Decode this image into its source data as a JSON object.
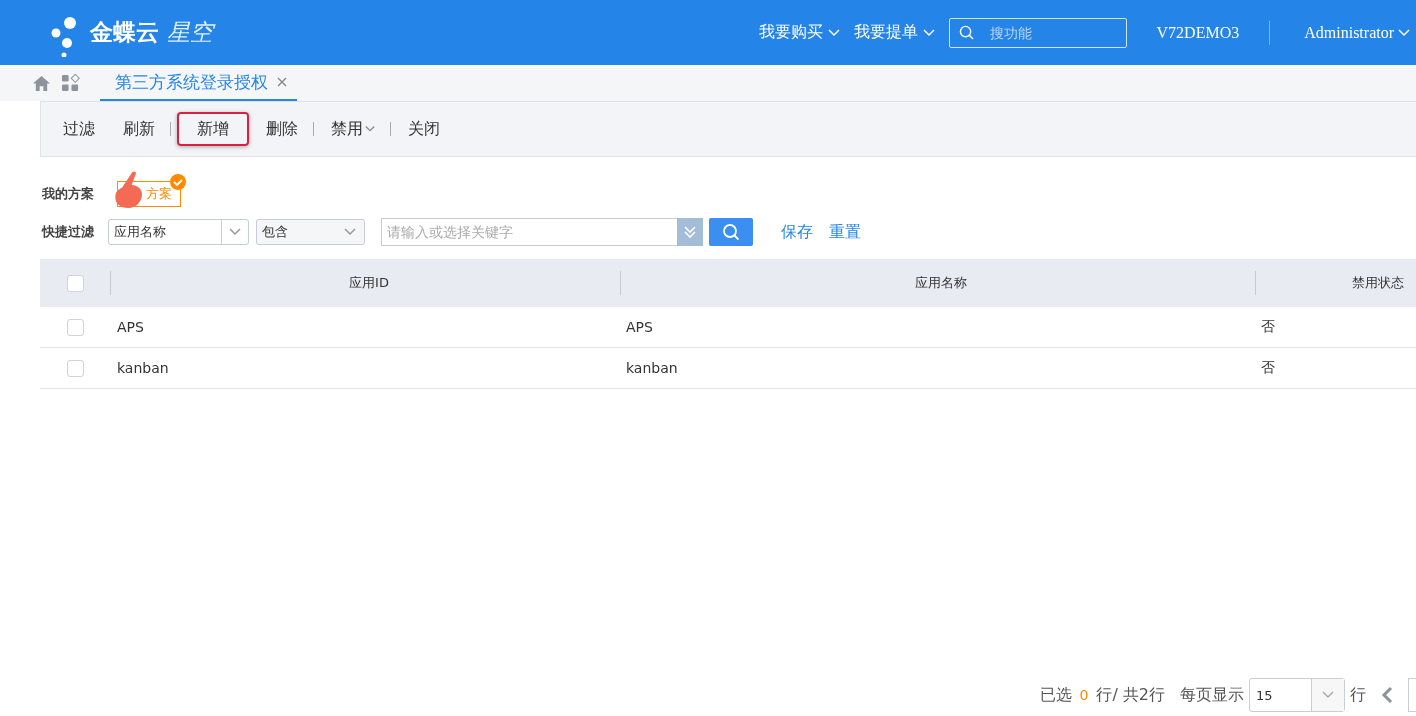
{
  "header": {
    "logo": {
      "brand": "金蝶云",
      "product": "星空"
    },
    "menus": [
      {
        "label": "我要购买"
      },
      {
        "label": "我要提单"
      }
    ],
    "search": {
      "placeholder": "搜功能"
    },
    "data_center": "V72DEMO3",
    "user": "Administrator"
  },
  "tabs": [
    {
      "label": "第三方系统登录授权",
      "selected": true
    }
  ],
  "toolbar": [
    {
      "label": "过滤",
      "separator_after": false,
      "dropdown": false,
      "highlighted": false
    },
    {
      "label": "刷新",
      "separator_after": true,
      "dropdown": false,
      "highlighted": false
    },
    {
      "label": "新增",
      "separator_after": false,
      "dropdown": false,
      "highlighted": true
    },
    {
      "label": "删除",
      "separator_after": true,
      "dropdown": false,
      "highlighted": false
    },
    {
      "label": "禁用",
      "separator_after": true,
      "dropdown": true,
      "highlighted": false
    },
    {
      "label": "关闭",
      "separator_after": false,
      "dropdown": false,
      "highlighted": false
    }
  ],
  "schemes": {
    "label": "我的方案",
    "items": [
      {
        "label": "方案",
        "selected": true
      }
    ]
  },
  "quick_filter": {
    "label": "快捷过滤",
    "field": "应用名称",
    "operator": "包含",
    "keyword_placeholder": "请输入或选择关键字",
    "actions": [
      "保存",
      "重置"
    ]
  },
  "table": {
    "columns": [
      "应用ID",
      "应用名称",
      "禁用状态"
    ],
    "header_checked": false,
    "rows": [
      {
        "checked": false,
        "cells": [
          "APS",
          "APS",
          "否"
        ]
      },
      {
        "checked": false,
        "cells": [
          "kanban",
          "kanban",
          "否"
        ]
      }
    ]
  },
  "footer": {
    "selected_prefix": "已选",
    "selected_count": "0",
    "selected_suffix": "行/",
    "total": "共2行",
    "page_size_label": "每页显示",
    "page_size": "15",
    "page_size_suffix": "行"
  }
}
